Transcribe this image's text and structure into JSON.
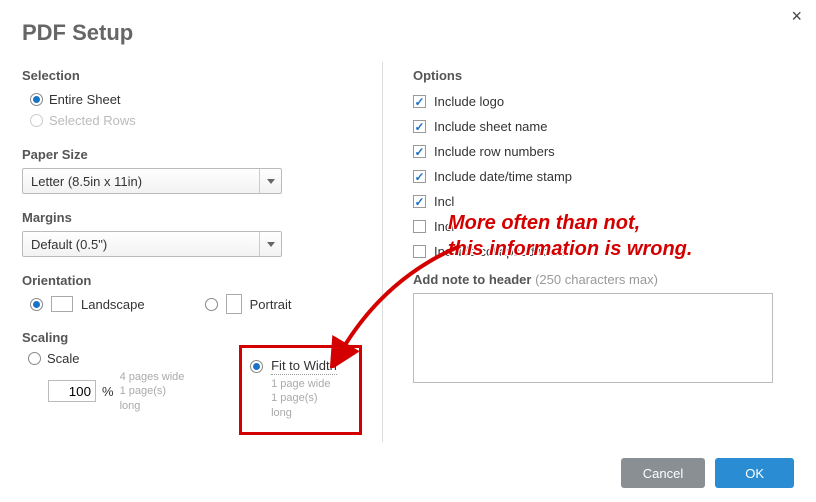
{
  "title": "PDF Setup",
  "close": "×",
  "left": {
    "selection": {
      "head": "Selection",
      "entire": "Entire Sheet",
      "selected": "Selected Rows"
    },
    "paper": {
      "head": "Paper Size",
      "value": "Letter (8.5in x 11in)"
    },
    "margins": {
      "head": "Margins",
      "value": "Default (0.5\")"
    },
    "orientation": {
      "head": "Orientation",
      "landscape": "Landscape",
      "portrait": "Portrait"
    },
    "scaling": {
      "head": "Scaling",
      "scale_label": "Scale",
      "scale_value": "100",
      "percent": "%",
      "scale_sub1": "4 pages wide",
      "scale_sub2": "1 page(s) long",
      "fit_label": "Fit to Width",
      "fit_sub1": "1 page wide",
      "fit_sub2": "1 page(s) long"
    }
  },
  "right": {
    "head": "Options",
    "opts": [
      {
        "label": "Include logo",
        "checked": true
      },
      {
        "label": "Include sheet name",
        "checked": true
      },
      {
        "label": "Include row numbers",
        "checked": true
      },
      {
        "label": "Include date/time stamp",
        "checked": true
      },
      {
        "label": "Incl",
        "checked": true
      },
      {
        "label": "Incl",
        "checked": false
      },
      {
        "label": "Include collapsed rows",
        "checked": false
      }
    ],
    "note_label": "Add note to header",
    "note_hint": "(250 characters max)"
  },
  "annotation": {
    "line1": "More often than not,",
    "line2": "this information is wrong."
  },
  "buttons": {
    "cancel": "Cancel",
    "ok": "OK"
  }
}
